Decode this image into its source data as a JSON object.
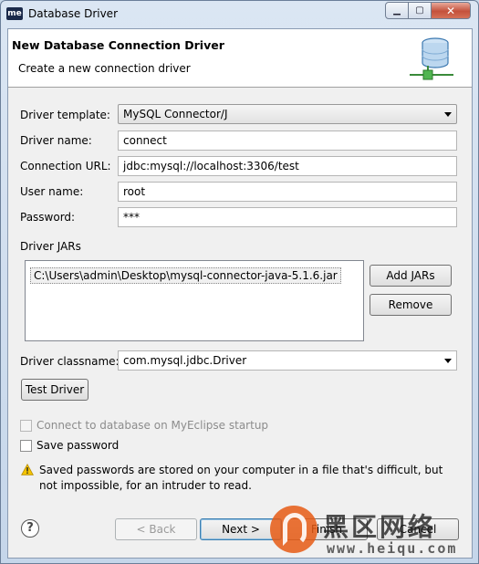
{
  "window": {
    "icon_text": "me",
    "title": "Database Driver",
    "minimize_glyph": "▁",
    "maximize_glyph": "▢",
    "close_glyph": "✕"
  },
  "banner": {
    "title": "New Database Connection Driver",
    "subtitle": "Create a new connection driver",
    "icon": "database-connection-icon"
  },
  "form": {
    "driver_template_label": "Driver template:",
    "driver_template_value": "MySQL Connector/J",
    "driver_name_label": "Driver name:",
    "driver_name_value": "connect",
    "connection_url_label": "Connection URL:",
    "connection_url_value": "jdbc:mysql://localhost:3306/test",
    "user_name_label": "User name:",
    "user_name_value": "root",
    "password_label": "Password:",
    "password_value": "***"
  },
  "jars": {
    "section_label": "Driver JARs",
    "items": [
      "C:\\Users\\admin\\Desktop\\mysql-connector-java-5.1.6.jar"
    ],
    "add_button": "Add JARs",
    "remove_button": "Remove"
  },
  "classname": {
    "label": "Driver classname:",
    "value": "com.mysql.jdbc.Driver"
  },
  "test_driver_button": "Test Driver",
  "options": {
    "connect_on_startup_label": "Connect to database on MyEclipse startup",
    "connect_on_startup_checked": false,
    "connect_on_startup_enabled": false,
    "save_password_label": "Save password",
    "save_password_checked": false
  },
  "warning": {
    "icon": "warning-icon",
    "line1": "Saved passwords are stored on your computer in a file that's difficult, but",
    "line2": "not impossible, for an intruder to read."
  },
  "footer": {
    "help_icon": "?",
    "back_button": "< Back",
    "next_button": "Next >",
    "finish_button": "Finish",
    "cancel_button": "Cancel"
  },
  "watermark": {
    "text": "黑区网络",
    "url": "www.heiqu.com"
  },
  "colors": {
    "accent": "#3c7fb1",
    "warning": "#f5c400",
    "db_icon_blue": "#4a90c9",
    "db_icon_green": "#3aa33a"
  }
}
